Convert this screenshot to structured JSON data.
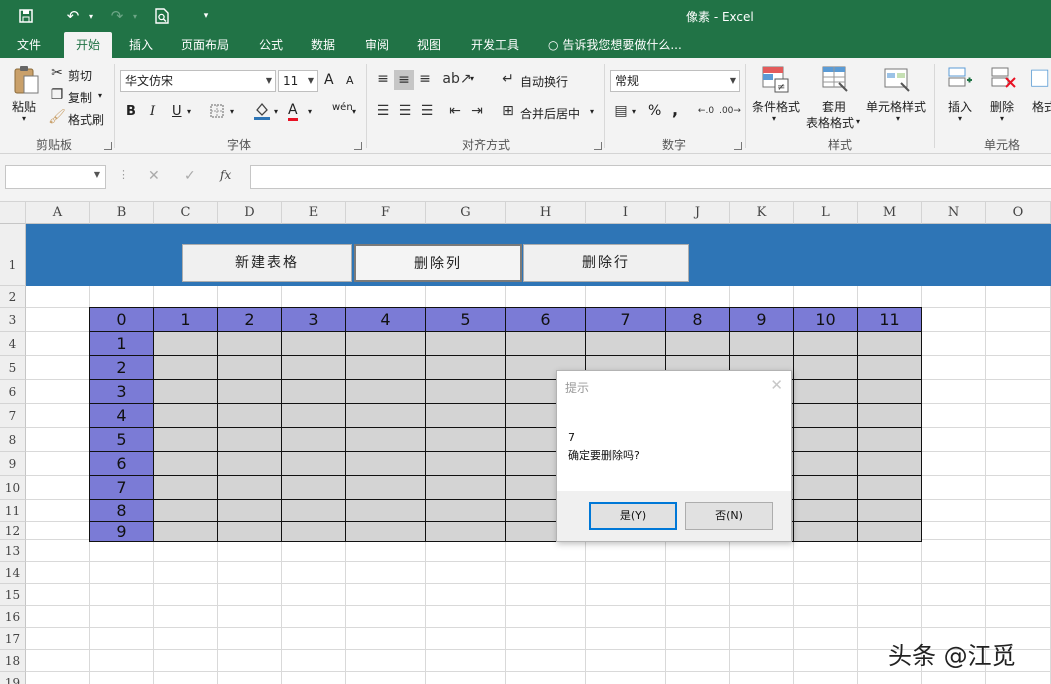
{
  "window": {
    "title": "像素 - Excel"
  },
  "menu": {
    "tabs": [
      "文件",
      "开始",
      "插入",
      "页面布局",
      "公式",
      "数据",
      "审阅",
      "视图",
      "开发工具"
    ],
    "active": "开始",
    "tell_me": "告诉我您想要做什么..."
  },
  "ribbon": {
    "clipboard": {
      "paste": "粘贴",
      "cut": "剪切",
      "copy": "复制",
      "format_painter": "格式刷",
      "label": "剪贴板"
    },
    "font": {
      "name": "华文仿宋",
      "size": "11",
      "bold": "B",
      "italic": "I",
      "underline": "U",
      "grow": "A",
      "shrink": "A",
      "font_color": "A",
      "phonetic": "wén",
      "label": "字体"
    },
    "alignment": {
      "wrap": "自动换行",
      "merge": "合并后居中",
      "label": "对齐方式"
    },
    "number": {
      "format": "常规",
      "percent": "%",
      "comma": ",",
      "label": "数字"
    },
    "styles": {
      "conditional": "条件格式",
      "table_line1": "套用",
      "table_line2": "表格格式",
      "cell_styles": "单元格样式",
      "label": "样式"
    },
    "cells": {
      "insert": "插入",
      "delete": "删除",
      "format": "格式",
      "label": "单元格"
    }
  },
  "formula_bar": {
    "fx": "fx",
    "cancel": "✕",
    "enter": "✓"
  },
  "sheet": {
    "columns": [
      "A",
      "B",
      "C",
      "D",
      "E",
      "F",
      "G",
      "H",
      "I",
      "J",
      "K",
      "L",
      "M",
      "N",
      "O"
    ],
    "rows": [
      "1",
      "2",
      "3",
      "4",
      "5",
      "6",
      "7",
      "8",
      "9",
      "10",
      "11",
      "12",
      "13",
      "14",
      "15",
      "16",
      "17",
      "18",
      "19"
    ],
    "buttons": {
      "new_table": "新建表格",
      "delete_column": "删除列",
      "delete_row": "删除行"
    },
    "table_header": [
      "0",
      "1",
      "2",
      "3",
      "4",
      "5",
      "6",
      "7",
      "8",
      "9",
      "10",
      "11"
    ],
    "table_row_labels": [
      "1",
      "2",
      "3",
      "4",
      "5",
      "6",
      "7",
      "8",
      "9"
    ]
  },
  "dialog": {
    "title": "提示",
    "close": "✕",
    "line1": "7",
    "line2": "确定要删除吗?",
    "yes": "是(Y)",
    "no": "否(N)"
  },
  "watermark": "头条 @江觅",
  "colors": {
    "title_bar": "#217346",
    "band": "#2e75b6",
    "table_header": "#7b7bd6",
    "table_body": "#d4d4d4"
  }
}
